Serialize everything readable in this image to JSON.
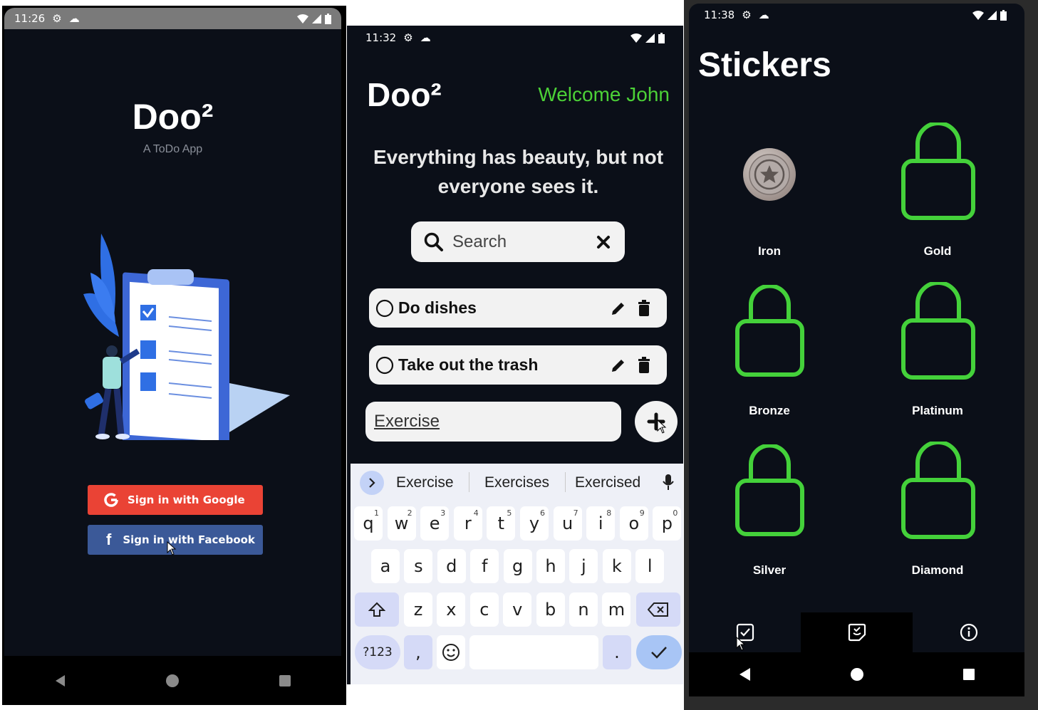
{
  "login": {
    "time": "11:26",
    "app_title": "Doo²",
    "subtitle": "A ToDo App",
    "google_label": "Sign in with Google",
    "facebook_label": "Sign in with Facebook",
    "colors": {
      "google": "#ea4335",
      "facebook": "#3b5998"
    }
  },
  "home": {
    "time": "11:32",
    "app_title": "Doo²",
    "welcome": "Welcome John",
    "quote": "Everything has beauty, but not everyone sees it.",
    "search_placeholder": "Search",
    "tasks": [
      {
        "label": "Do dishes"
      },
      {
        "label": "Take out the trash"
      }
    ],
    "new_task_value": "Exercise",
    "suggestions": [
      "Exercise",
      "Exercises",
      "Exercised"
    ],
    "keyboard": {
      "row1": [
        {
          "k": "q",
          "n": "1"
        },
        {
          "k": "w",
          "n": "2"
        },
        {
          "k": "e",
          "n": "3"
        },
        {
          "k": "r",
          "n": "4"
        },
        {
          "k": "t",
          "n": "5"
        },
        {
          "k": "y",
          "n": "6"
        },
        {
          "k": "u",
          "n": "7"
        },
        {
          "k": "i",
          "n": "8"
        },
        {
          "k": "o",
          "n": "9"
        },
        {
          "k": "p",
          "n": "0"
        }
      ],
      "row2": [
        "a",
        "s",
        "d",
        "f",
        "g",
        "h",
        "j",
        "k",
        "l"
      ],
      "row3": [
        "z",
        "x",
        "c",
        "v",
        "b",
        "n",
        "m"
      ],
      "symbols_label": "?123",
      "comma": ",",
      "period": "."
    },
    "colors": {
      "accent": "#4cd137"
    }
  },
  "stickers": {
    "time": "11:38",
    "title": "Stickers",
    "items": [
      {
        "label": "Iron",
        "unlocked": true
      },
      {
        "label": "Gold",
        "unlocked": false
      },
      {
        "label": "Bronze",
        "unlocked": false
      },
      {
        "label": "Platinum",
        "unlocked": false
      },
      {
        "label": "Silver",
        "unlocked": false
      },
      {
        "label": "Diamond",
        "unlocked": false
      }
    ],
    "tabs": [
      "todo-tab",
      "stickers-tab",
      "info-tab"
    ],
    "colors": {
      "lock": "#44d13a"
    }
  }
}
